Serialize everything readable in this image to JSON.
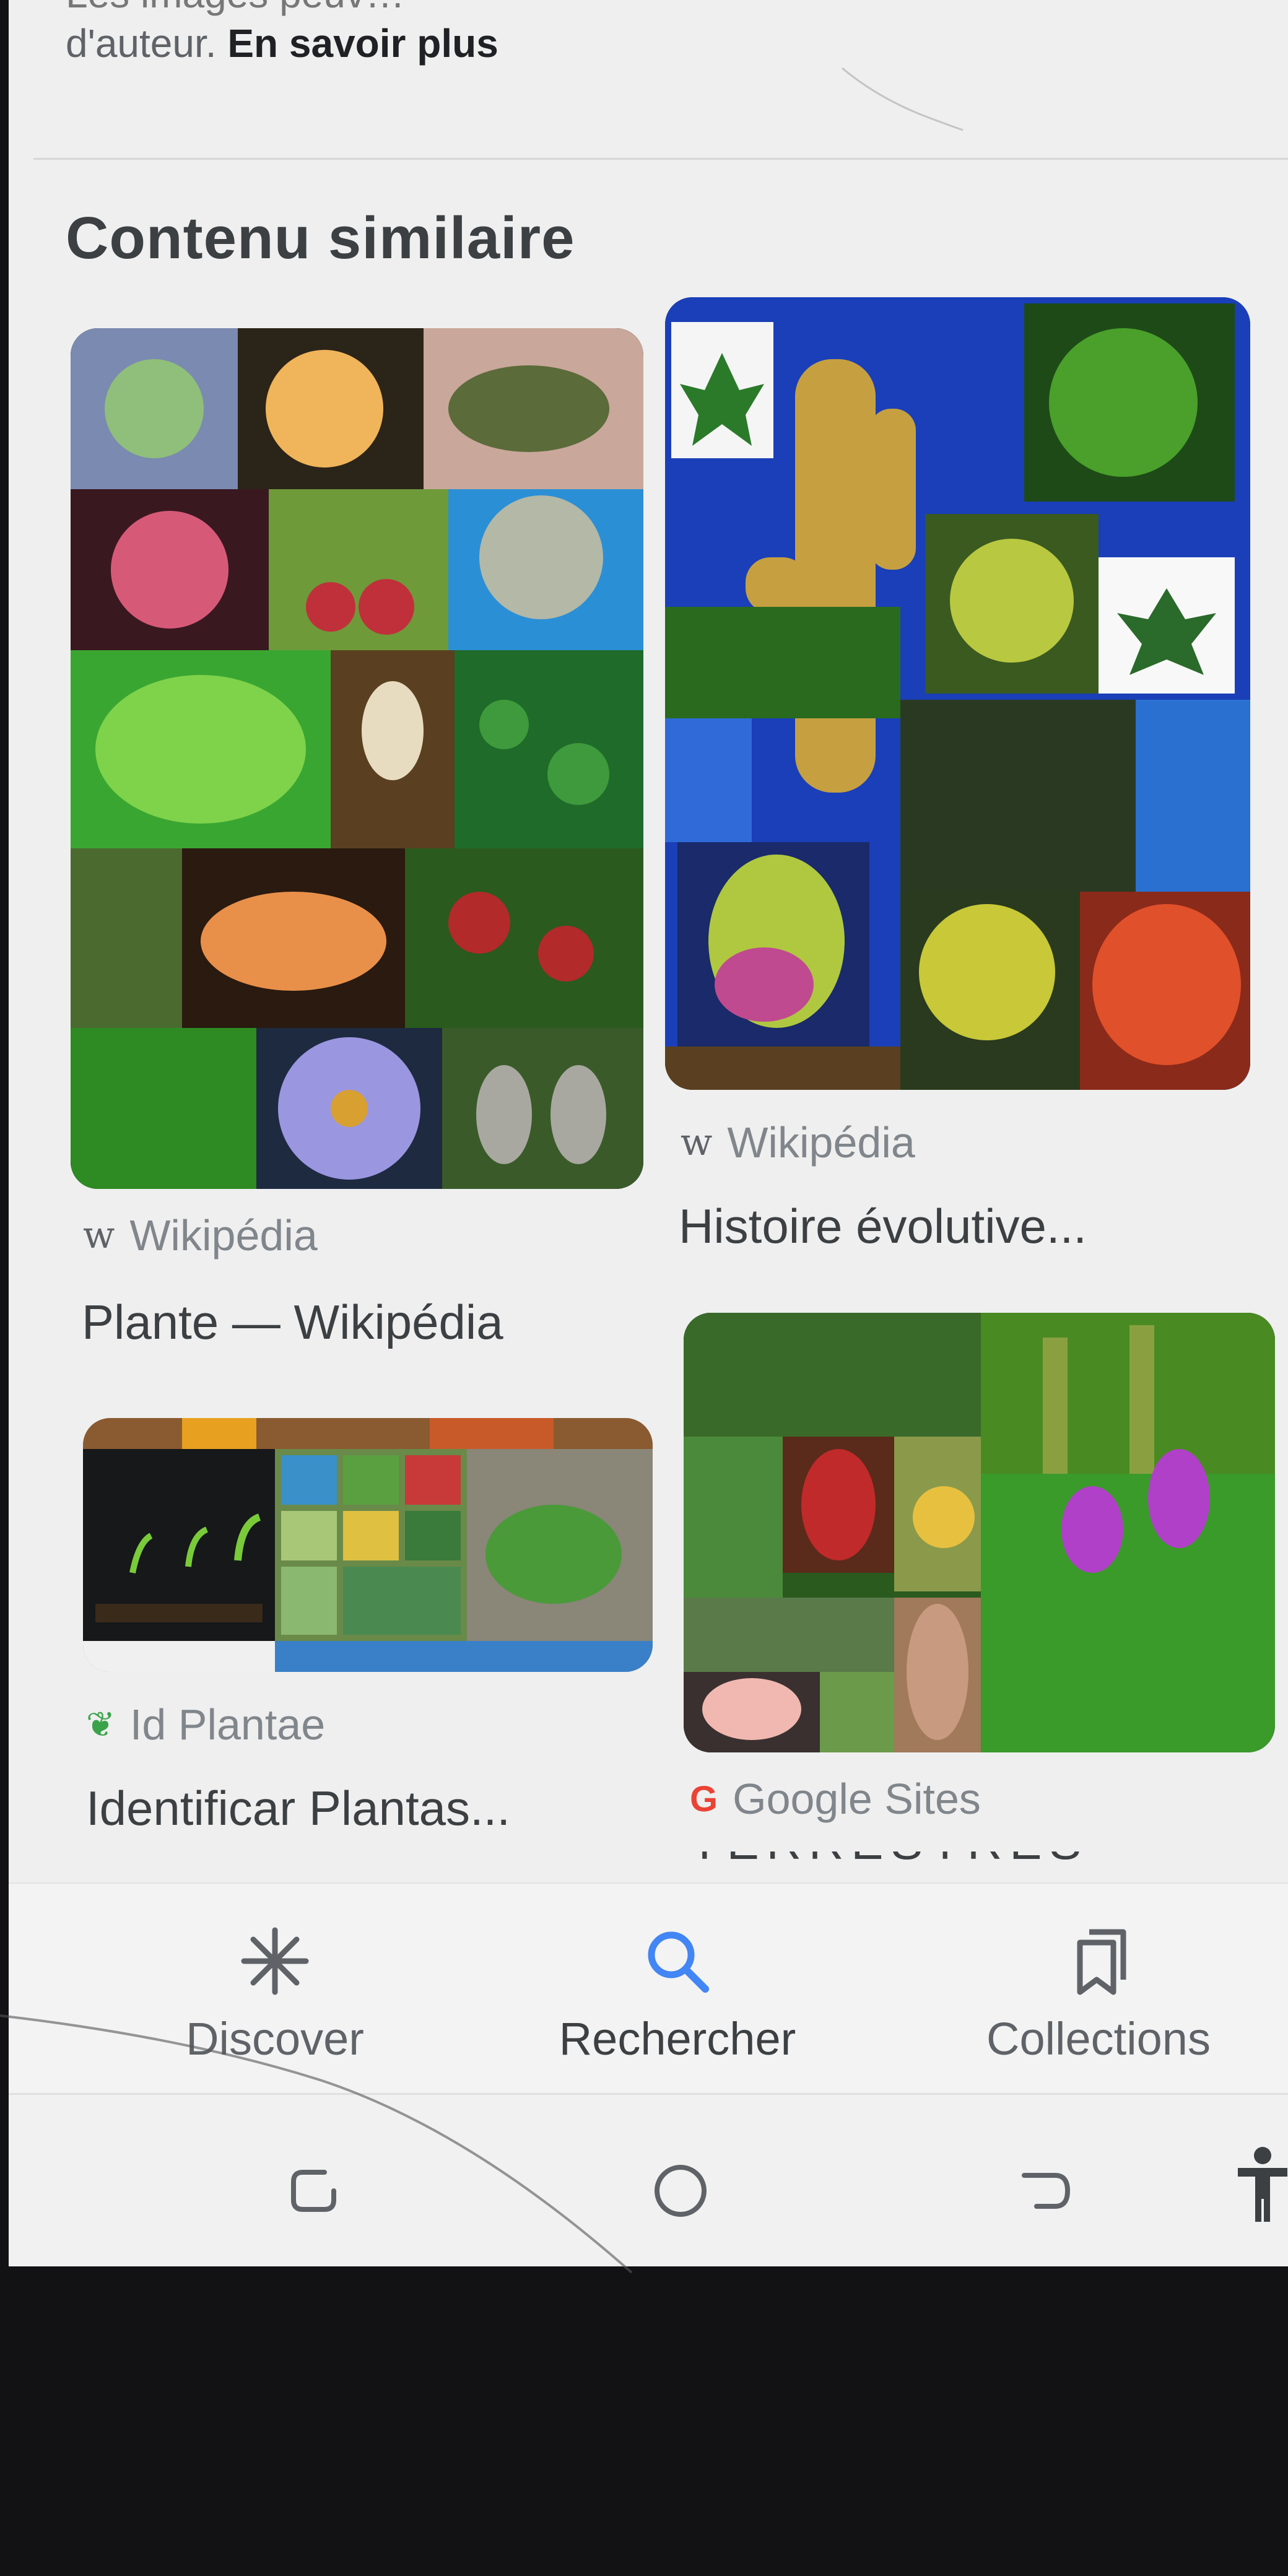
{
  "copyright": {
    "line1": "Les images peuv…",
    "line2_text": "d'auteur.",
    "line2_link": "En savoir plus"
  },
  "section_title": "Contenu similaire",
  "results": [
    {
      "source": "Wikipédia",
      "source_icon": "wikipedia-w-icon",
      "source_glyph": "w",
      "title": "Plante — Wikipédia"
    },
    {
      "source": "Wikipédia",
      "source_icon": "wikipedia-w-icon",
      "source_glyph": "w",
      "title": "Histoire évolutive..."
    },
    {
      "source": "Id Plantae",
      "source_icon": "leaf-icon",
      "source_glyph": "❦",
      "title": "Identificar Plantas..."
    },
    {
      "source": "Google Sites",
      "source_icon": "google-g-icon",
      "source_glyph": "G",
      "title": "TERRESTRES O..."
    }
  ],
  "bottom_nav": {
    "items": [
      {
        "label": "Discover",
        "icon": "asterisk-icon"
      },
      {
        "label": "Rechercher",
        "icon": "search-icon"
      },
      {
        "label": "Collections",
        "icon": "collections-icon"
      }
    ],
    "active": "Rechercher",
    "accent": "#4285f4"
  },
  "system_nav": {
    "buttons": [
      "recents-icon",
      "home-icon",
      "back-icon",
      "accessibility-icon"
    ]
  }
}
